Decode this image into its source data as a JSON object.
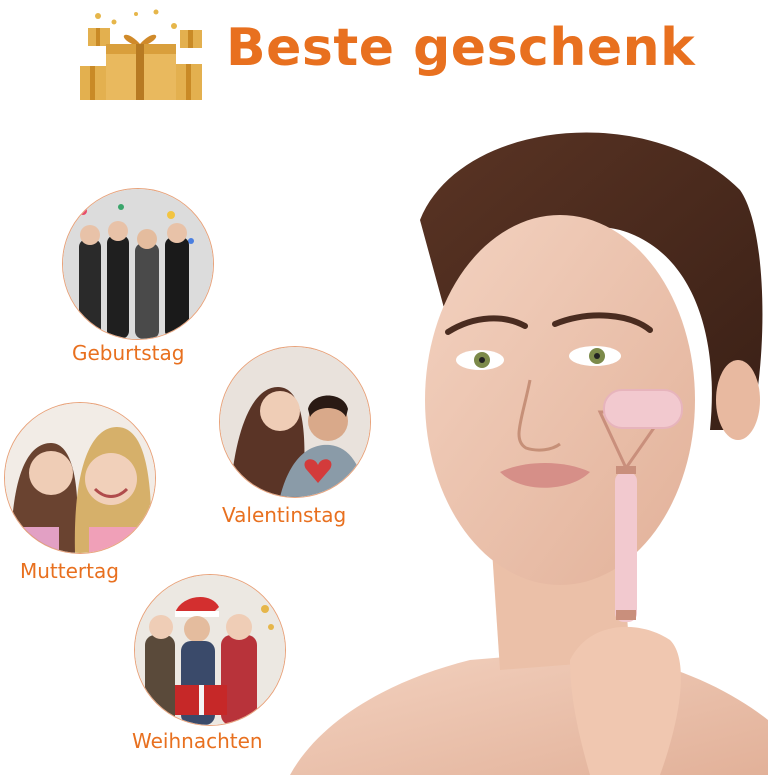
{
  "header": {
    "title": "Beste geschenk",
    "icon": "gift-boxes-icon"
  },
  "occasions": [
    {
      "label": "Geburtstag",
      "icon": "party-photo"
    },
    {
      "label": "Valentinstag",
      "icon": "couple-photo"
    },
    {
      "label": "Muttertag",
      "icon": "mother-daughter-photo"
    },
    {
      "label": "Weihnachten",
      "icon": "christmas-family-photo"
    }
  ],
  "colors": {
    "accent": "#e8701f",
    "roller": "#f2c9cf",
    "frame": "#c98f7c"
  }
}
